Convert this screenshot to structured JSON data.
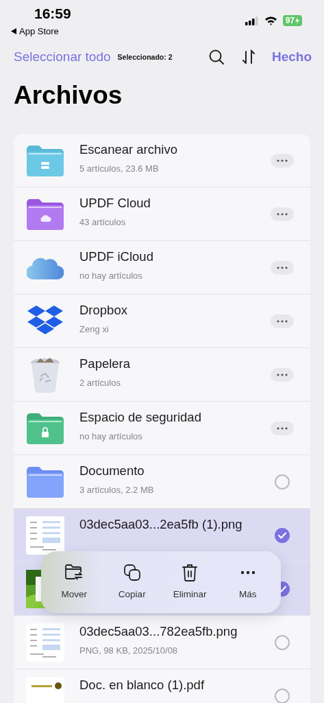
{
  "status_bar": {
    "time": "16:59",
    "back_label": "App Store",
    "battery": "97"
  },
  "nav_bar": {
    "select_all": "Seleccionar todo",
    "selected_count": "Seleccionado: 2",
    "done": "Hecho"
  },
  "title": "Archivos",
  "items": [
    {
      "kind": "location",
      "title": "Escanear archivo",
      "subtitle": "5 artículos, 23.6 MB"
    },
    {
      "kind": "location",
      "title": "UPDF Cloud",
      "subtitle": "43 artículos"
    },
    {
      "kind": "location",
      "title": "UPDF iCloud",
      "subtitle": "no hay artículos"
    },
    {
      "kind": "location",
      "title": "Dropbox",
      "subtitle": "Zeng xi"
    },
    {
      "kind": "location",
      "title": "Papelera",
      "subtitle": "2 artículos"
    },
    {
      "kind": "location",
      "title": "Espacio de seguridad",
      "subtitle": "no hay artículos"
    },
    {
      "kind": "item",
      "title": "Documento",
      "subtitle": "3 artículos, 2.2 MB",
      "selected": false
    },
    {
      "kind": "item",
      "title": "03dec5aa03...2ea5fb (1).png",
      "selected": true
    },
    {
      "kind": "item",
      "selected": true
    },
    {
      "kind": "item",
      "title": "03dec5aa03...782ea5fb.png",
      "subtitle": "PNG, 98 KB, 2025/10/08",
      "selected": false
    },
    {
      "kind": "item",
      "title": "Doc. en blanco (1).pdf",
      "selected": false
    }
  ],
  "actions": [
    {
      "label": "Mover"
    },
    {
      "label": "Copiar"
    },
    {
      "label": "Eliminar"
    },
    {
      "label": "Más"
    }
  ]
}
